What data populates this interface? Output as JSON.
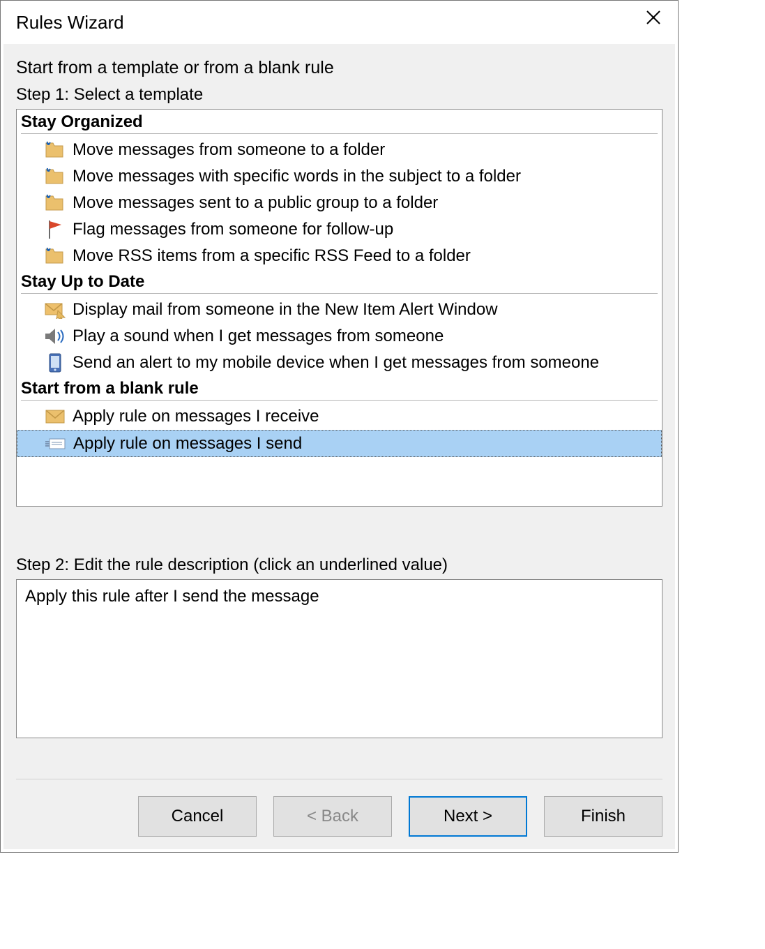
{
  "window": {
    "title": "Rules Wizard"
  },
  "intro": "Start from a template or from a blank rule",
  "step1_label": "Step 1: Select a template",
  "sections": [
    {
      "title": "Stay Organized",
      "items": [
        {
          "icon": "folder-move-icon",
          "label": "Move messages from someone to a folder"
        },
        {
          "icon": "folder-move-icon",
          "label": "Move messages with specific words in the subject to a folder"
        },
        {
          "icon": "folder-move-icon",
          "label": "Move messages sent to a public group to a folder"
        },
        {
          "icon": "flag-icon",
          "label": "Flag messages from someone for follow-up"
        },
        {
          "icon": "folder-move-icon",
          "label": "Move RSS items from a specific RSS Feed to a folder"
        }
      ]
    },
    {
      "title": "Stay Up to Date",
      "items": [
        {
          "icon": "alert-mail-icon",
          "label": "Display mail from someone in the New Item Alert Window"
        },
        {
          "icon": "sound-icon",
          "label": "Play a sound when I get messages from someone"
        },
        {
          "icon": "mobile-icon",
          "label": "Send an alert to my mobile device when I get messages from someone"
        }
      ]
    },
    {
      "title": "Start from a blank rule",
      "items": [
        {
          "icon": "envelope-icon",
          "label": "Apply rule on messages I receive"
        },
        {
          "icon": "envelope-send-icon",
          "label": "Apply rule on messages I send",
          "selected": true
        }
      ]
    }
  ],
  "step2_label": "Step 2: Edit the rule description (click an underlined value)",
  "description_text": "Apply this rule after I send the message",
  "buttons": {
    "cancel": "Cancel",
    "back": "< Back",
    "next": "Next >",
    "finish": "Finish"
  }
}
